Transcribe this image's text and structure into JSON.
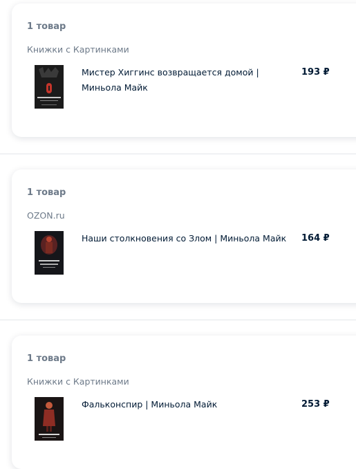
{
  "orders": [
    {
      "count": "1 товар",
      "seller": "Книжки с Картинками",
      "item_title": "Мистер Хиггинс возвращается домой | Миньола Майк",
      "price": "193 ₽",
      "cover_icon": "book-cover-mister-higgins"
    },
    {
      "count": "1 товар",
      "seller": "OZON.ru",
      "item_title": "Наши столкновения со Злом | Миньола Майк",
      "price": "164 ₽",
      "cover_icon": "book-cover-nashi-stolknoveniya"
    },
    {
      "count": "1 товар",
      "seller": "Книжки с Картинками",
      "item_title": "Фальконспир | Миньола Майк",
      "price": "253 ₽",
      "cover_icon": "book-cover-falkonspir"
    }
  ]
}
